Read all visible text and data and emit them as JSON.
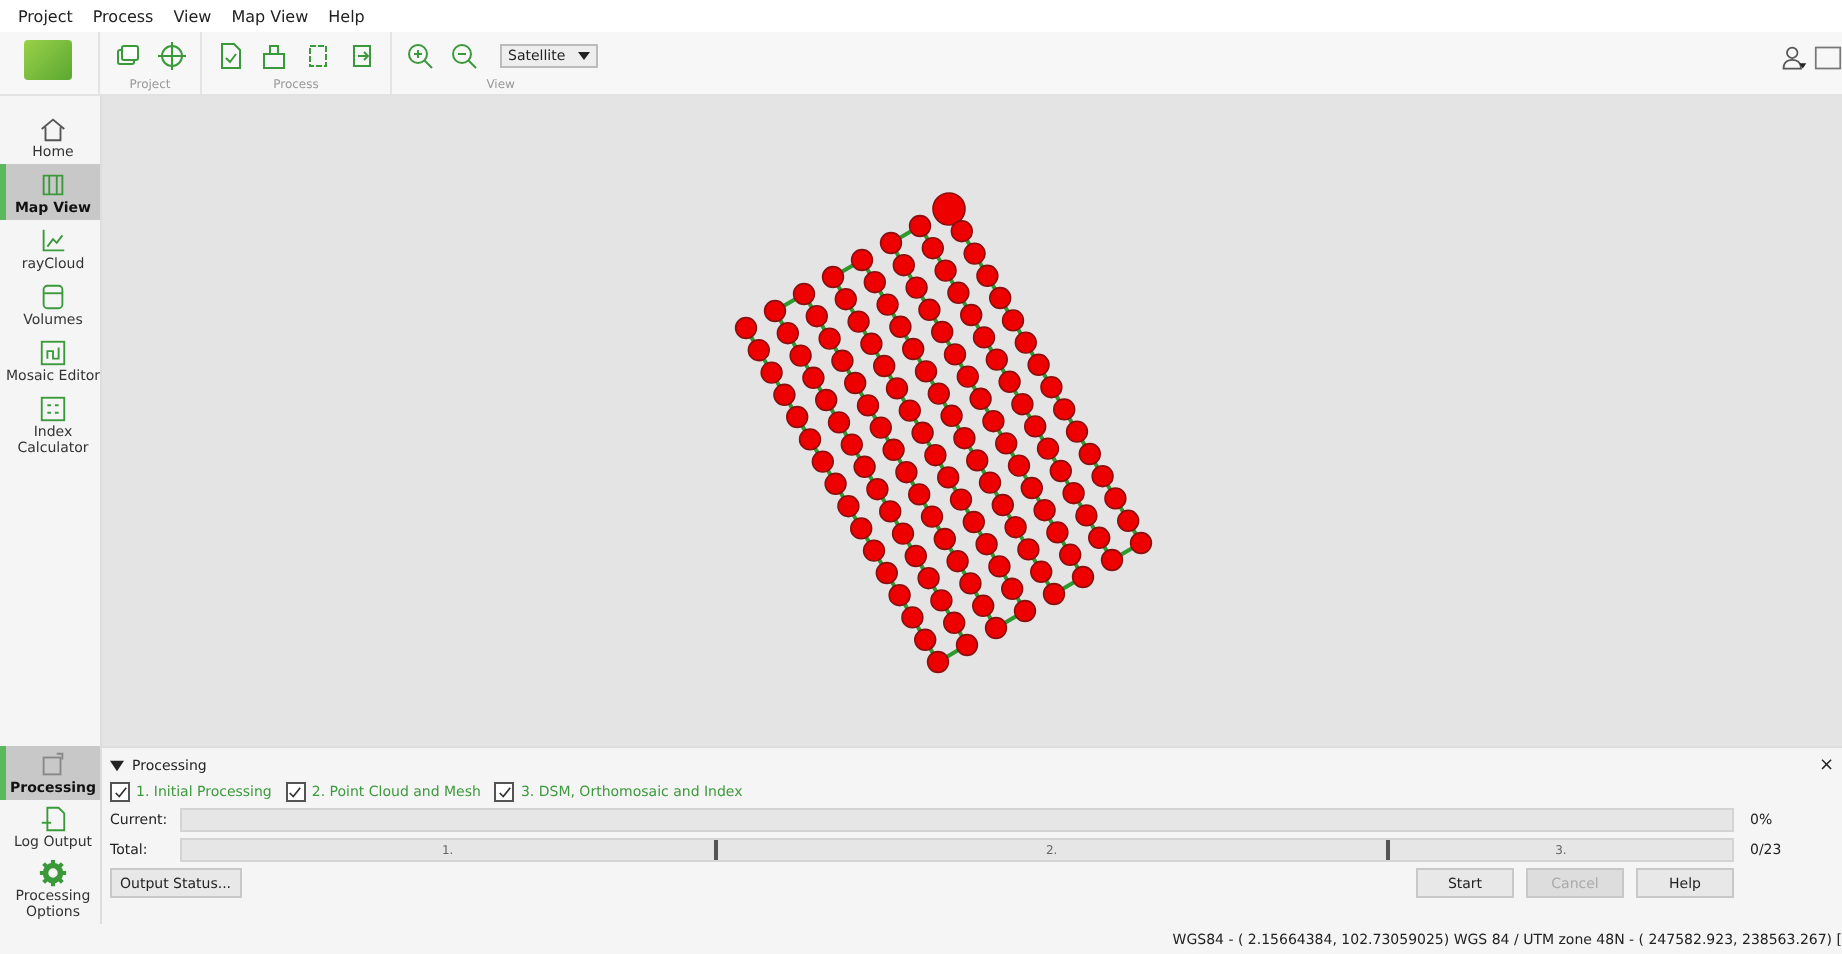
{
  "menu": [
    "Project",
    "Process",
    "View",
    "Map View",
    "Help"
  ],
  "toolbar": {
    "groups": [
      {
        "label": "Project",
        "tools": [
          {
            "kind": "layers"
          },
          {
            "kind": "crosshair"
          }
        ]
      },
      {
        "label": "Process",
        "tools": [
          {
            "kind": "doc"
          },
          {
            "kind": "tray"
          },
          {
            "kind": "frame"
          },
          {
            "kind": "export"
          }
        ]
      },
      {
        "label": "View",
        "tools": [
          {
            "kind": "zoom-in"
          },
          {
            "kind": "zoom-out"
          }
        ]
      }
    ],
    "basemap": "Satellite"
  },
  "sidebar": {
    "items": [
      {
        "label": "Home",
        "kind": "home",
        "selected": false
      },
      {
        "label": "Map View",
        "kind": "map",
        "selected": true
      },
      {
        "label": "rayCloud",
        "kind": "cloud",
        "selected": false
      },
      {
        "label": "Volumes",
        "kind": "volume",
        "selected": false
      },
      {
        "label": "Mosaic Editor",
        "kind": "mosaic",
        "selected": false
      },
      {
        "label": "Index Calculator",
        "kind": "index",
        "selected": false
      }
    ],
    "bottom_items": [
      {
        "label": "Processing",
        "kind": "processing",
        "selected": true
      },
      {
        "label": "Log Output",
        "kind": "log",
        "selected": false
      },
      {
        "label": "Processing Options",
        "kind": "gear",
        "selected": false
      }
    ]
  },
  "processing": {
    "title": "Processing",
    "expanded": true,
    "close": "×",
    "steps": [
      {
        "label": "1. Initial Processing",
        "checked": true
      },
      {
        "label": "2. Point Cloud and Mesh",
        "checked": true
      },
      {
        "label": "3. DSM, Orthomosaic and Index",
        "checked": true
      }
    ],
    "current": {
      "label": "Current:",
      "reading": "0%"
    },
    "total": {
      "label": "Total:",
      "segments": [
        "1.",
        "2.",
        "3."
      ],
      "reading": "0/23"
    },
    "buttons": [
      {
        "label": "Output Status...",
        "disabled": false
      },
      {
        "label": "Start",
        "disabled": false
      },
      {
        "label": "Cancel",
        "disabled": true
      },
      {
        "label": "Help",
        "disabled": false
      }
    ]
  },
  "status_bar": "WGS84 - ( 2.15664384, 102.73059025) WGS 84 / UTM zone 48N - ( 247582.923, 238563.267) ["
}
